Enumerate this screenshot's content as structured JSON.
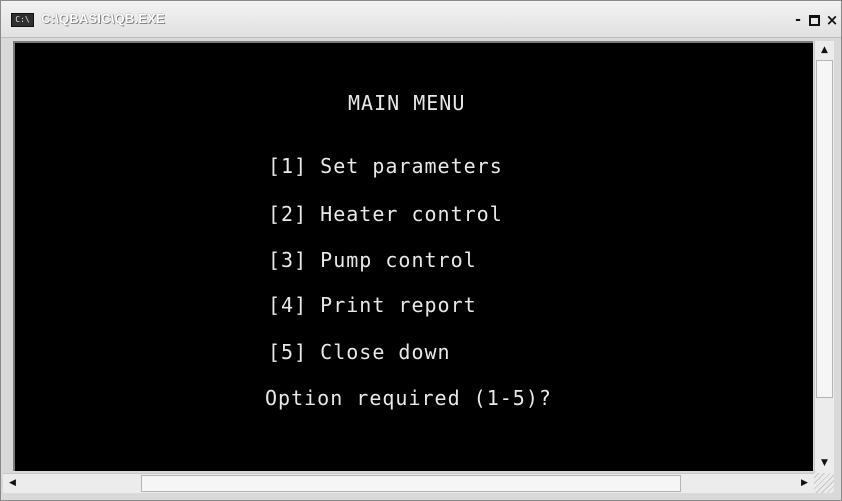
{
  "window": {
    "title": "C:\\QBASIC\\QB.EXE",
    "icon_text": "C:\\",
    "minimize_label": "-",
    "close_label": "×"
  },
  "console": {
    "heading": "MAIN MENU",
    "menu_items": [
      "[1] Set parameters",
      "[2] Heater control",
      "[3] Pump control",
      "[4] Print report",
      "[5] Close down"
    ],
    "prompt": "Option required (1-5)?"
  },
  "scrollbars": {
    "up_arrow": "▲",
    "down_arrow": "▼",
    "left_arrow": "◀",
    "right_arrow": "▶"
  },
  "colors": {
    "console_background": "#000000",
    "console_text": "#e8e8e8",
    "chrome": "#d9d9d9"
  }
}
